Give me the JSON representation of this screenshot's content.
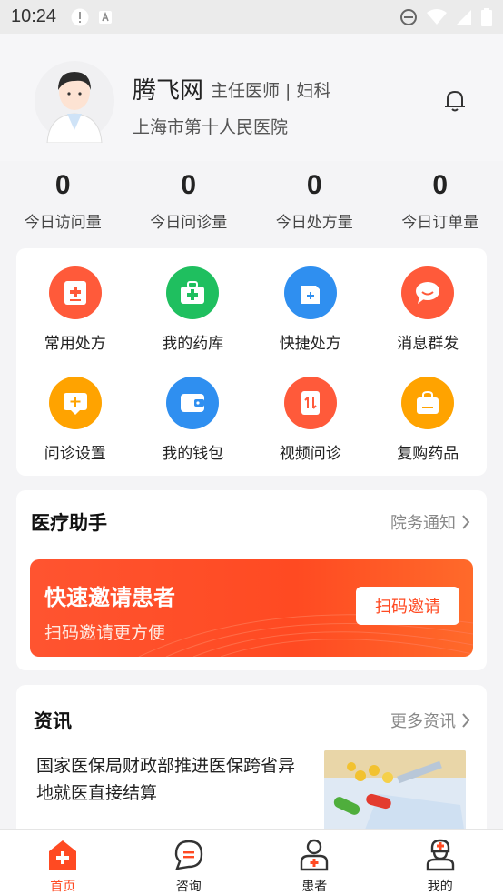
{
  "status_bar": {
    "time": "10:24"
  },
  "profile": {
    "name": "腾飞网",
    "title": "主任医师 | 妇科",
    "hospital": "上海市第十人民医院"
  },
  "stats": [
    {
      "value": "0",
      "label": "今日访问量"
    },
    {
      "value": "0",
      "label": "今日问诊量"
    },
    {
      "value": "0",
      "label": "今日处方量"
    },
    {
      "value": "0",
      "label": "今日订单量"
    }
  ],
  "features": [
    {
      "label": "常用处方",
      "icon": "prescription-icon",
      "color": "#ff5a3a"
    },
    {
      "label": "我的药库",
      "icon": "medicine-box-icon",
      "color": "#1fbf5f"
    },
    {
      "label": "快捷处方",
      "icon": "quick-prescription-icon",
      "color": "#2f8ff0"
    },
    {
      "label": "消息群发",
      "icon": "message-icon",
      "color": "#ff5a3a"
    },
    {
      "label": "问诊设置",
      "icon": "consult-settings-icon",
      "color": "#ffa300"
    },
    {
      "label": "我的钱包",
      "icon": "wallet-icon",
      "color": "#2f8ff0"
    },
    {
      "label": "视频问诊",
      "icon": "video-consult-icon",
      "color": "#ff5a3a"
    },
    {
      "label": "复购药品",
      "icon": "repurchase-icon",
      "color": "#ffa300"
    }
  ],
  "assistant": {
    "title": "医疗助手",
    "link": "院务通知",
    "invite_title": "快速邀请患者",
    "invite_sub": "扫码邀请更方便",
    "invite_button": "扫码邀请"
  },
  "news": {
    "title": "资讯",
    "link": "更多资讯",
    "headline": "国家医保局财政部推进医保跨省异地就医直接结算"
  },
  "tabs": [
    {
      "label": "首页",
      "icon": "home-icon",
      "active": true
    },
    {
      "label": "咨询",
      "icon": "chat-icon",
      "active": false
    },
    {
      "label": "患者",
      "icon": "patient-icon",
      "active": false
    },
    {
      "label": "我的",
      "icon": "doctor-icon",
      "active": false
    }
  ],
  "colors": {
    "accent": "#ff4a22",
    "green": "#1fbf5f",
    "blue": "#2f8ff0",
    "orange": "#ffa300"
  }
}
